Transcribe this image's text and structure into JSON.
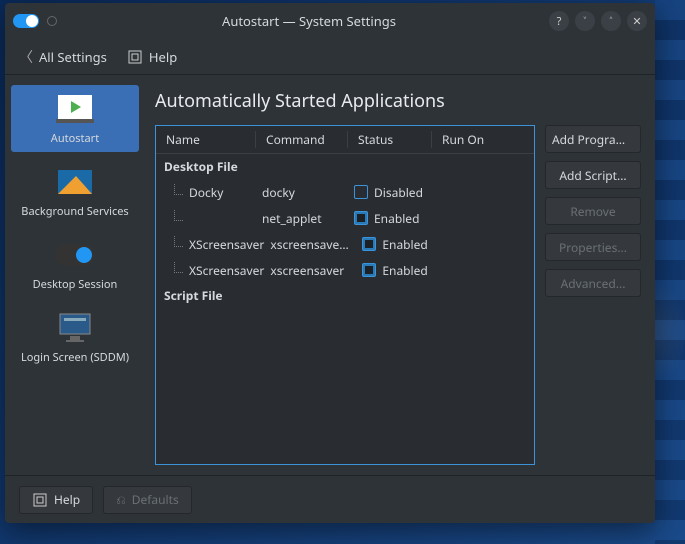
{
  "window": {
    "title": "Autostart — System Settings"
  },
  "nav": {
    "all_settings": "All Settings",
    "help": "Help"
  },
  "sidebar": {
    "items": [
      {
        "label": "Autostart",
        "active": true
      },
      {
        "label": "Background Services"
      },
      {
        "label": "Desktop Session"
      },
      {
        "label": "Login Screen (SDDM)"
      }
    ]
  },
  "main": {
    "title": "Automatically Started Applications",
    "columns": {
      "name": "Name",
      "command": "Command",
      "status": "Status",
      "run_on": "Run On"
    },
    "sections": {
      "desktop_file": "Desktop File",
      "script_file": "Script File"
    },
    "rows": [
      {
        "name": "Docky",
        "command": "docky",
        "status": "Disabled",
        "enabled": false
      },
      {
        "name": "",
        "command": "net_applet",
        "status": "Enabled",
        "enabled": true
      },
      {
        "name": "XScreensaver",
        "command": "xscreensaver ...",
        "status": "Enabled",
        "enabled": true
      },
      {
        "name": "XScreensaver",
        "command": "xscreensaver",
        "status": "Enabled",
        "enabled": true
      }
    ]
  },
  "actions": {
    "add_program": "Add Program...",
    "add_script": "Add Script...",
    "remove": "Remove",
    "properties": "Properties...",
    "advanced": "Advanced..."
  },
  "footer": {
    "help": "Help",
    "defaults": "Defaults"
  }
}
